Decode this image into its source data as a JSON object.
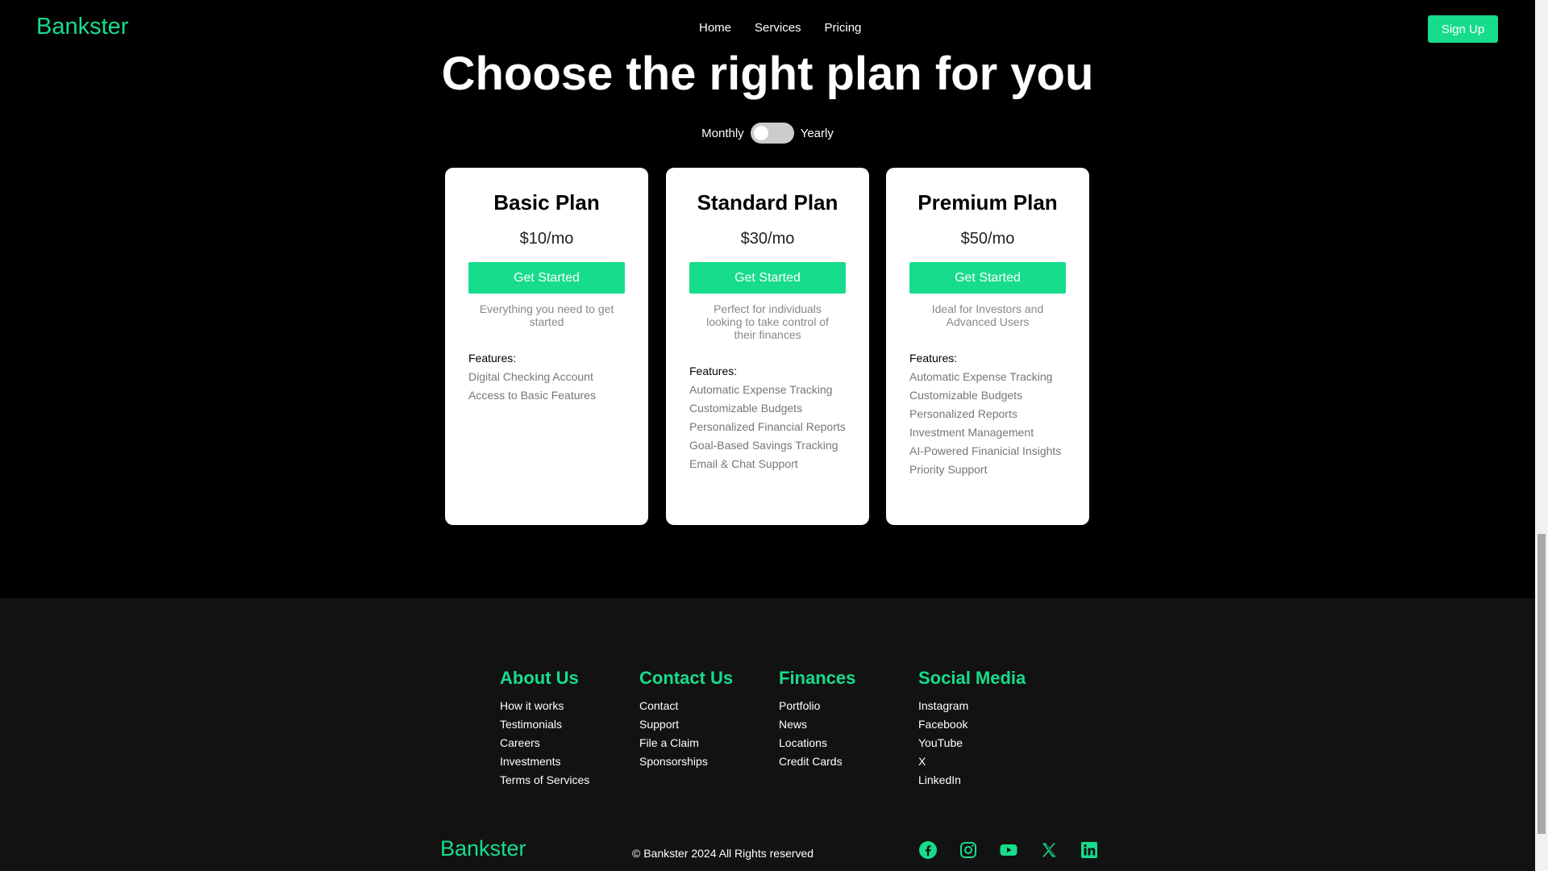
{
  "brand": {
    "name": "Bankster",
    "accent": "#17dc8c"
  },
  "nav": {
    "links": [
      "Home",
      "Services",
      "Pricing"
    ],
    "signup_label": "Sign Up"
  },
  "hero": {
    "title": "Choose the right plan for you"
  },
  "billing": {
    "monthly_label": "Monthly",
    "yearly_label": "Yearly",
    "selected": "Monthly"
  },
  "plans": [
    {
      "name": "Basic Plan",
      "price": "$10/mo",
      "cta": "Get Started",
      "description": "Everything you need to get started",
      "features_label": "Features:",
      "features": [
        "Digital Checking Account",
        "Access to Basic Features"
      ]
    },
    {
      "name": "Standard Plan",
      "price": "$30/mo",
      "cta": "Get Started",
      "description": "Perfect for individuals looking to take control of their finances",
      "features_label": "Features:",
      "features": [
        "Automatic Expense Tracking",
        "Customizable Budgets",
        "Personalized Financial Reports",
        "Goal-Based Savings Tracking",
        "Email & Chat Support"
      ]
    },
    {
      "name": "Premium Plan",
      "price": "$50/mo",
      "cta": "Get Started",
      "description": "Ideal for Investors and Advanced Users",
      "features_label": "Features:",
      "features": [
        "Automatic Expense Tracking",
        "Customizable Budgets",
        "Personalized Reports",
        "Investment Management",
        "AI-Powered Finanicial Insights",
        "Priority Support"
      ]
    }
  ],
  "footer": {
    "columns": [
      {
        "title": "About Us",
        "links": [
          "How it works",
          "Testimonials",
          "Careers",
          "Investments",
          "Terms of Services"
        ]
      },
      {
        "title": "Contact Us",
        "links": [
          "Contact",
          "Support",
          "File a Claim",
          "Sponsorships"
        ]
      },
      {
        "title": "Finances",
        "links": [
          "Portfolio",
          "News",
          "Locations",
          "Credit Cards"
        ]
      },
      {
        "title": "Social Media",
        "links": [
          "Instagram",
          "Facebook",
          "YouTube",
          "X",
          "LinkedIn"
        ]
      }
    ],
    "logo": "Bankster",
    "copyright": "© Bankster 2024 All Rights reserved",
    "social_icons": [
      "facebook-icon",
      "instagram-icon",
      "youtube-icon",
      "x-icon",
      "linkedin-icon"
    ]
  }
}
